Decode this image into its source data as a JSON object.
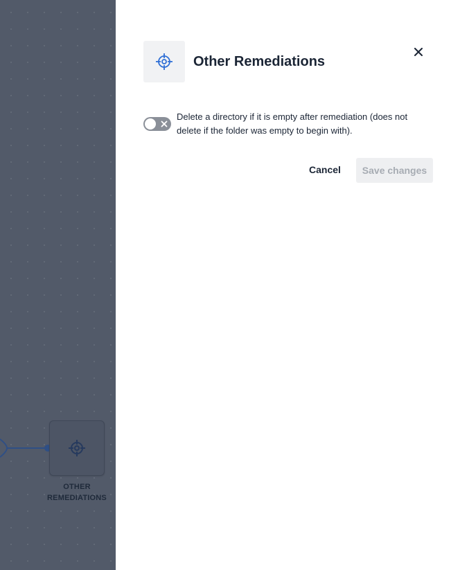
{
  "canvas": {
    "node": {
      "label_line1": "OTHER",
      "label_line2": "REMEDIATIONS",
      "icon": "crosshair-target-icon"
    },
    "colors": {
      "backdrop": "#525a69",
      "connector": "#2f4f85"
    }
  },
  "panel": {
    "title": "Other Remediations",
    "header_icon": "crosshair-target-icon",
    "close_icon": "close-icon",
    "option": {
      "enabled": false,
      "text": "Delete a directory if it is empty after remediation (does not delete if the folder was empty to begin with)."
    },
    "actions": {
      "cancel_label": "Cancel",
      "save_label": "Save changes",
      "save_enabled": false
    },
    "colors": {
      "accent": "#2f6fd6",
      "title": "#1b2535",
      "disabled_text": "#a7acb3"
    }
  }
}
